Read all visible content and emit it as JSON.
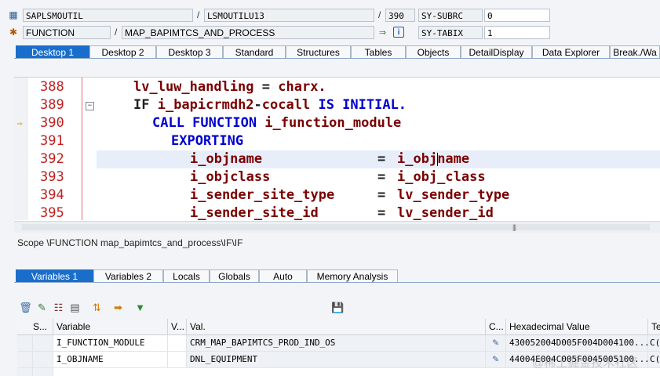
{
  "header": {
    "row1": {
      "program": "SAPLSMOUTIL",
      "include": "LSMOUTILU13",
      "line": "390",
      "sysfield_name": "SY-SUBRC",
      "sysfield_value": "0"
    },
    "row2": {
      "type": "FUNCTION",
      "name": "MAP_BAPIMTCS_AND_PROCESS",
      "sysfield_name": "SY-TABIX",
      "sysfield_value": "1"
    },
    "slash": "/"
  },
  "desktop_tabs": [
    "Desktop 1",
    "Desktop 2",
    "Desktop 3",
    "Standard",
    "Structures",
    "Tables",
    "Objects",
    "DetailDisplay",
    "Data Explorer",
    "Break./Wa"
  ],
  "code": {
    "lines": [
      {
        "num": "388"
      },
      {
        "num": "389"
      },
      {
        "num": "390"
      },
      {
        "num": "391"
      },
      {
        "num": "392"
      },
      {
        "num": "393"
      },
      {
        "num": "394"
      },
      {
        "num": "395"
      }
    ],
    "tokens": {
      "l388a": "lv_luw_handling",
      "l388b": " = ",
      "l388c": "charx.",
      "l389a": "IF ",
      "l389b": "i_bapicrmdh2",
      "l389c": "-",
      "l389d": "cocall",
      "l389e": " IS INITIAL.",
      "l390a": "CALL FUNCTION ",
      "l390b": "i_function_module",
      "l391a": "EXPORTING",
      "l392a": "i_objname",
      "l392b": "=",
      "l392c1": "i_obj",
      "l392c2": "name",
      "l393a": "i_objclass",
      "l393b": "=",
      "l393c": "i_obj_class",
      "l394a": "i_sender_site_type",
      "l394b": "=",
      "l394c": "lv_sender_type",
      "l395a": "i_sender_site_id",
      "l395b": "=",
      "l395c": "lv_sender_id"
    }
  },
  "scope": "Scope \\FUNCTION map_bapimtcs_and_process\\IF\\IF",
  "variable_tabs": [
    "Variables 1",
    "Variables 2",
    "Locals",
    "Globals",
    "Auto",
    "Memory Analysis"
  ],
  "grid": {
    "headers": [
      "S...",
      "Variable",
      "V...",
      "Val.",
      "C...",
      "Hexadecimal Value",
      "Te"
    ],
    "rows": [
      {
        "variable": "I_FUNCTION_MODULE",
        "value": "CRM_MAP_BAPIMTCS_PROD_IND_OS",
        "hex": "430052004D005F004D004100...",
        "text": "C("
      },
      {
        "variable": "I_OBJNAME",
        "value": "DNL_EQUIPMENT",
        "hex": "44004E004C005F0045005100...",
        "text": "C("
      }
    ]
  },
  "watermark": "@稀土掘金技术社区",
  "icons": {
    "program": "program-icon",
    "function": "function-icon",
    "nav": "navigate-icon",
    "info": "info-icon",
    "marker": "current-line-arrow-icon",
    "fold": "fold-collapse-icon",
    "toolbar": [
      "delete-icon",
      "change-variable-icon",
      "delete-all-icon",
      "insert-icon",
      "sort-icon",
      "transfer-icon",
      "filter-icon",
      "save-icon"
    ],
    "edit": "pencil-icon"
  },
  "colors": {
    "tab_active": "#1a6ecb",
    "keyword": "#0000d0",
    "identifier": "#7a0000",
    "line_number": "#c02020",
    "current_line": "#e8eef9"
  }
}
